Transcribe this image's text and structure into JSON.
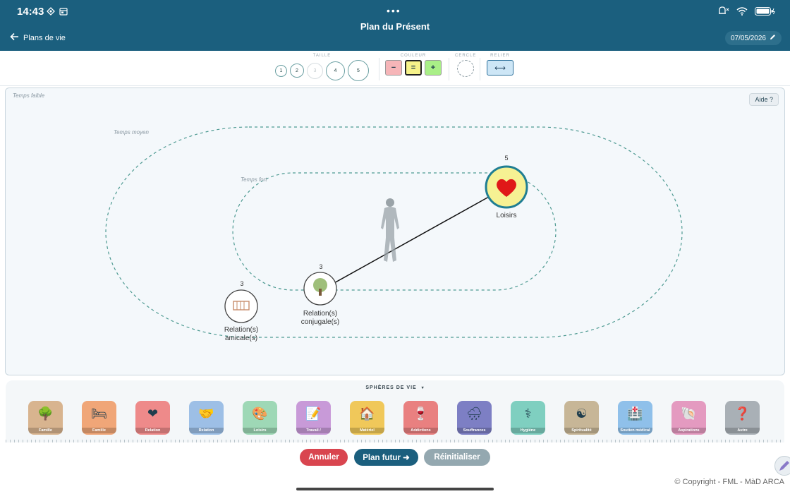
{
  "status": {
    "time": "14:43"
  },
  "header": {
    "title": "Plan du Présent",
    "back_label": "Plans de vie",
    "date": "07/05/2026",
    "dots": "•••"
  },
  "toolbar": {
    "size_label": "TAILLE",
    "sizes": [
      "1",
      "2",
      "3",
      "4",
      "5"
    ],
    "color_label": "COULEUR",
    "colors": {
      "minus": "−",
      "equal": "=",
      "plus": "+"
    },
    "circle_label": "CERCLE",
    "link_label": "RELIER",
    "link_symbol": "⟷"
  },
  "canvas": {
    "zone_low": "Temps faible",
    "zone_mid": "Temps moyen",
    "zone_high": "Temps fort",
    "help_button": "Aide ?",
    "nodes": [
      {
        "label_line1": "Loisirs",
        "label_line2": "",
        "size": "5",
        "icon": "heart-icon"
      },
      {
        "label_line1": "Relation(s)",
        "label_line2": "conjugale(s)",
        "size": "3",
        "icon": "tree-icon"
      },
      {
        "label_line1": "Relation(s)",
        "label_line2": "amicale(s)",
        "size": "3",
        "icon": "crib-icon"
      }
    ]
  },
  "spheres": {
    "title": "SPHÈRES DE VIE",
    "items": [
      {
        "label": "Famille",
        "color": "#d8b48f",
        "icon": "🌳"
      },
      {
        "label": "Famille",
        "color": "#f0a678",
        "icon": "🛏"
      },
      {
        "label": "Relation",
        "color": "#ee8a8a",
        "icon": "❤"
      },
      {
        "label": "Relation",
        "color": "#9dbfe6",
        "icon": "🤝"
      },
      {
        "label": "Loisirs",
        "color": "#9ed8b6",
        "icon": "🎨"
      },
      {
        "label": "Travail /",
        "color": "#c89ad8",
        "icon": "📝"
      },
      {
        "label": "Matériel",
        "color": "#f0c85a",
        "icon": "🏠"
      },
      {
        "label": "Addictions",
        "color": "#e98080",
        "icon": "🍷"
      },
      {
        "label": "Souffrances",
        "color": "#7d7fc4",
        "icon": "🌧"
      },
      {
        "label": "Hygiène",
        "color": "#7fcfc0",
        "icon": "⚕"
      },
      {
        "label": "Spiritualité",
        "color": "#c7b697",
        "icon": "☯"
      },
      {
        "label": "Soutien médical",
        "color": "#8fc0ea",
        "icon": "🏥"
      },
      {
        "label": "Aspirations",
        "color": "#e49ac0",
        "icon": "🐚"
      },
      {
        "label": "Autre",
        "color": "#a9b0b6",
        "icon": "❓"
      }
    ]
  },
  "actions": {
    "cancel": "Annuler",
    "future_plan": "Plan futur ➜",
    "reset": "Réinitialiser"
  },
  "footer": {
    "copyright": "© Copyright - FML - MàD ARCA"
  }
}
